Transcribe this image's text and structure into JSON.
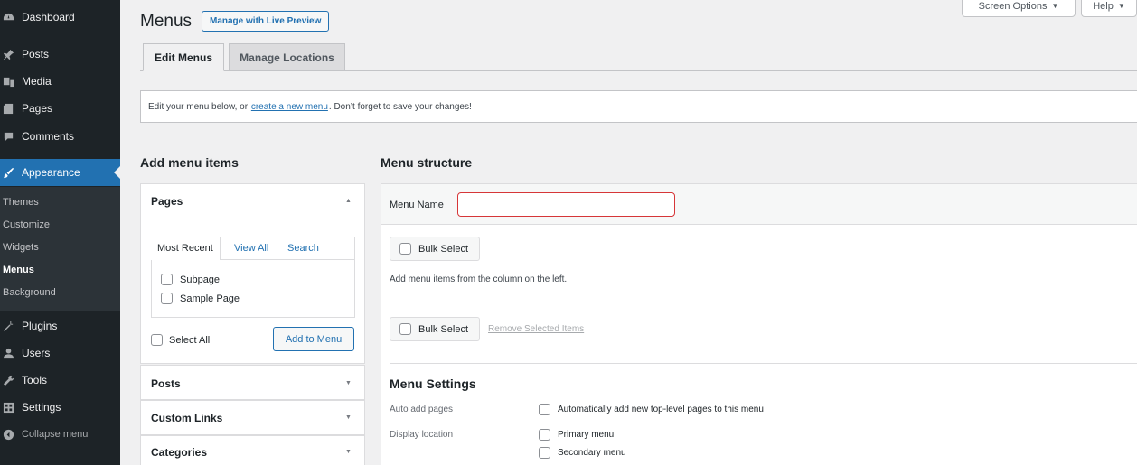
{
  "sidebar": {
    "items": [
      {
        "label": "Dashboard",
        "icon": "dashboard-icon"
      },
      {
        "label": "Posts",
        "icon": "pin-icon"
      },
      {
        "label": "Media",
        "icon": "media-icon"
      },
      {
        "label": "Pages",
        "icon": "pages-icon"
      },
      {
        "label": "Comments",
        "icon": "comments-icon"
      },
      {
        "label": "Appearance",
        "icon": "brush-icon"
      },
      {
        "label": "Plugins",
        "icon": "plug-icon"
      },
      {
        "label": "Users",
        "icon": "users-icon"
      },
      {
        "label": "Tools",
        "icon": "wrench-icon"
      },
      {
        "label": "Settings",
        "icon": "settings-icon"
      },
      {
        "label": "Collapse menu",
        "icon": "collapse-icon"
      }
    ],
    "submenu": [
      "Themes",
      "Customize",
      "Widgets",
      "Menus",
      "Background"
    ],
    "active_item": "Appearance",
    "current_sub": "Menus"
  },
  "topbar": {
    "screen_options": "Screen Options",
    "help": "Help"
  },
  "header": {
    "title": "Menus",
    "live_preview": "Manage with Live Preview"
  },
  "tabs": [
    {
      "label": "Edit Menus"
    },
    {
      "label": "Manage Locations"
    }
  ],
  "notice": {
    "before": "Edit your menu below, or",
    "link": "create a new menu",
    "after": ". Don’t forget to save your changes!"
  },
  "add_menu_items": {
    "title": "Add menu items",
    "pages": {
      "heading": "Pages",
      "subtabs": [
        "Most Recent",
        "View All",
        "Search"
      ],
      "items": [
        "Subpage",
        "Sample Page"
      ],
      "select_all": "Select All",
      "add_button": "Add to Menu"
    },
    "sections": [
      "Posts",
      "Custom Links",
      "Categories"
    ]
  },
  "menu_structure": {
    "title": "Menu structure",
    "menu_name_label": "Menu Name",
    "menu_name_value": "",
    "bulk_select": "Bulk Select",
    "help": "Add menu items from the column on the left.",
    "remove_selected": "Remove Selected Items",
    "settings": {
      "title": "Menu Settings",
      "auto_add_label": "Auto add pages",
      "auto_add_option": "Automatically add new top-level pages to this menu",
      "display_location_label": "Display location",
      "locations": [
        "Primary menu",
        "Secondary menu"
      ]
    }
  },
  "colors": {
    "sidebar_bg": "#1d2327",
    "accent": "#2271b1",
    "error_border": "#d63638"
  }
}
